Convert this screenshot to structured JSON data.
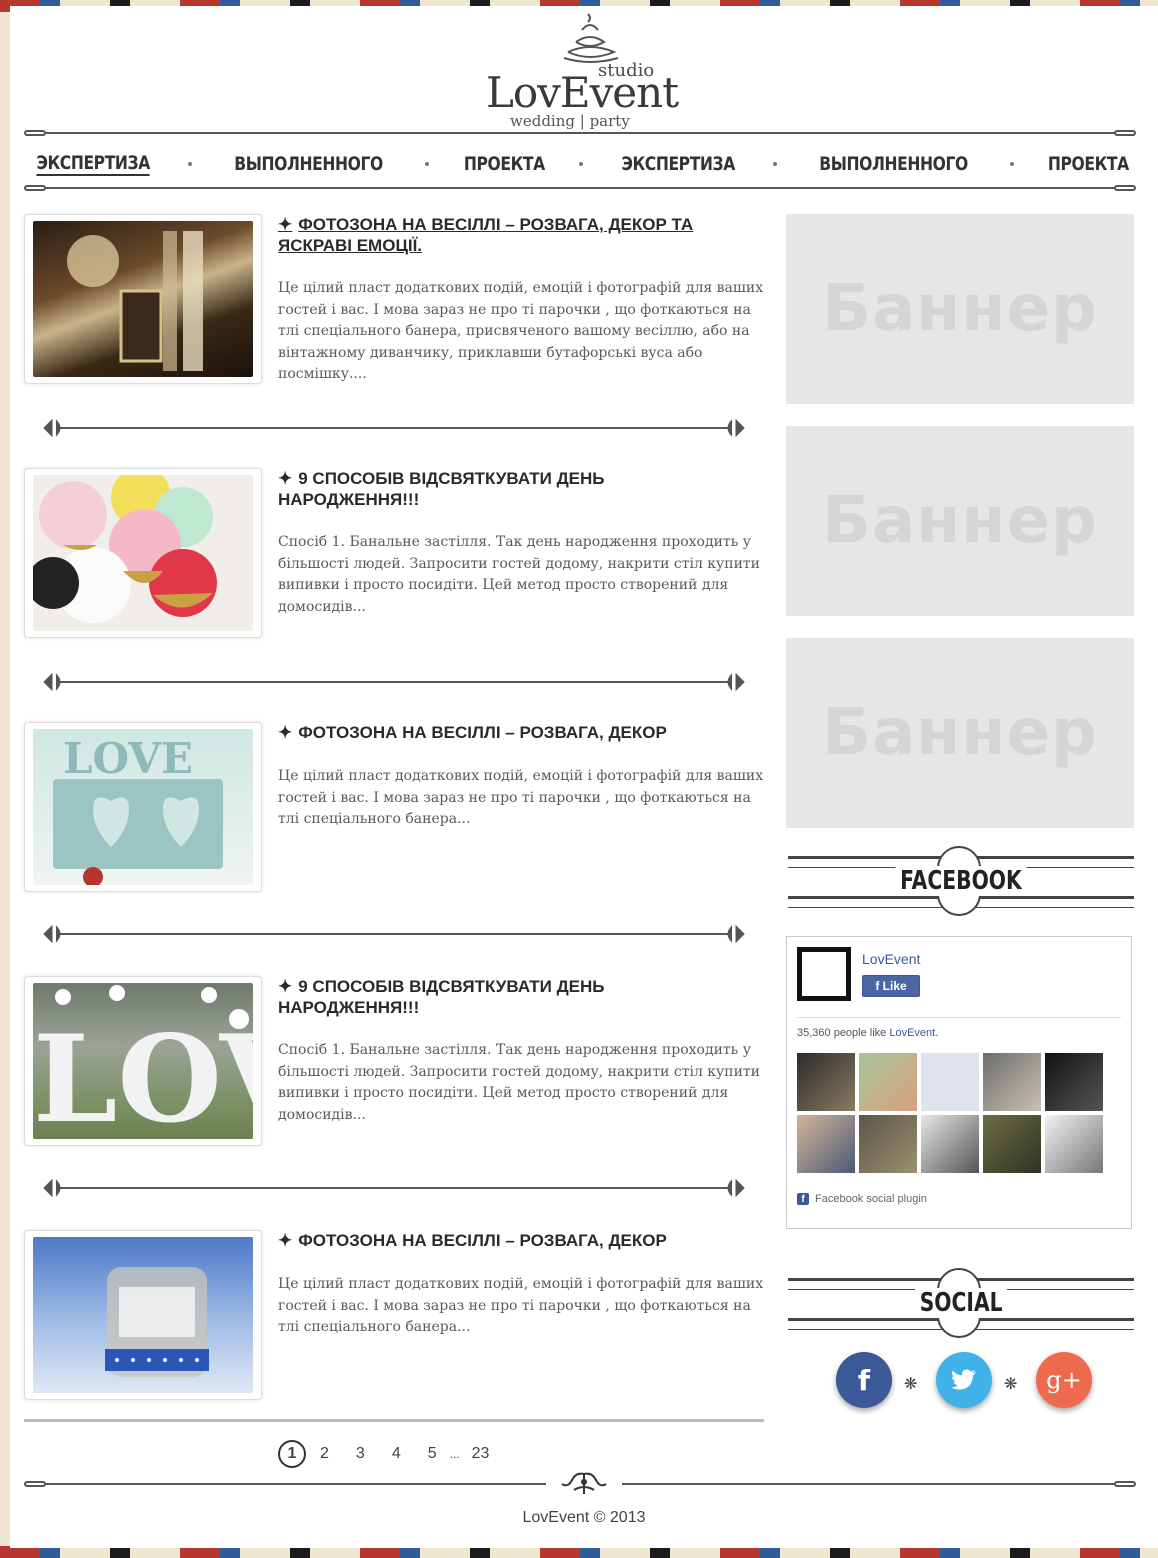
{
  "logo": {
    "studio": "studio",
    "name": "LovEvent",
    "tagline": "wedding | party"
  },
  "nav": [
    "ЭКСПЕРТИЗА",
    "ВЫПОЛНЕННОГО",
    "ПРОЕКТА",
    "ЭКСПЕРТИЗА",
    "ВЫПОЛНЕННОГО",
    "ПРОЕКТА"
  ],
  "posts": [
    {
      "title": "ФОТОЗОНА НА ВЕСІЛЛІ – РОЗВАГА, ДЕКОР ТА ЯСКРАВІ ЕМОЦІЇ.",
      "excerpt": "Це цілий пласт додаткових подій, емоцій і фотографій для ваших гостей і вас. І мова зараз не про ті парочки , що фоткаються на тлі спеціального банера, присвяченого вашому весіллю, або на вінтажному диванчику, приклавши бутафорські вуса або посмішку...."
    },
    {
      "title": "9 СПОСОБІВ ВІДСВЯТКУВАТИ ДЕНЬ НАРОДЖЕННЯ!!!",
      "excerpt": "Спосіб 1. Банальне застілля. Так день народження проходить у більшості людей. Запросити гостей додому, накрити стіл купити випивки і просто посидіти. Цей метод просто створений для домосидів..."
    },
    {
      "title": "ФОТОЗОНА НА ВЕСІЛЛІ – РОЗВАГА, ДЕКОР",
      "excerpt": "Це цілий пласт додаткових подій, емоцій і фотографій для ваших гостей і вас. І мова зараз не про ті парочки , що фоткаються на тлі спеціального банера..."
    },
    {
      "title": "9 СПОСОБІВ ВІДСВЯТКУВАТИ ДЕНЬ НАРОДЖЕННЯ!!!",
      "excerpt": "Спосіб 1. Банальне застілля. Так день народження проходить у більшості людей. Запросити гостей додому, накрити стіл купити випивки і просто посидіти. Цей метод просто створений для домосидів..."
    },
    {
      "title": "ФОТОЗОНА НА ВЕСІЛЛІ – РОЗВАГА, ДЕКОР",
      "excerpt": "Це цілий пласт додаткових подій, емоцій і фотографій для ваших гостей і вас. І мова зараз не про ті парочки , що фоткаються на тлі спеціального банера..."
    }
  ],
  "banners": [
    "Баннер",
    "Баннер",
    "Баннер"
  ],
  "facebook": {
    "heading": "FACEBOOK",
    "page_name": "LovEvent",
    "like_label": "Like",
    "count_text": "35,360 people like",
    "count_link": "LovEvent.",
    "plugin_label": "Facebook social plugin"
  },
  "social": {
    "heading": "SOCIAL",
    "facebook_icon": "f",
    "twitter_icon": "twitter-bird-icon",
    "gplus_icon": "g+"
  },
  "pagination": {
    "current": "1",
    "pages": [
      "2",
      "3",
      "4",
      "5"
    ],
    "ellipsis": "...",
    "last": "23"
  },
  "footer": {
    "copyright": "LovEvent  © 2013"
  },
  "colors": {
    "facebook": "#3b5998",
    "twitter": "#3fb3e8",
    "gplus": "#ee6a4f",
    "banner": "#e6e6e6"
  }
}
